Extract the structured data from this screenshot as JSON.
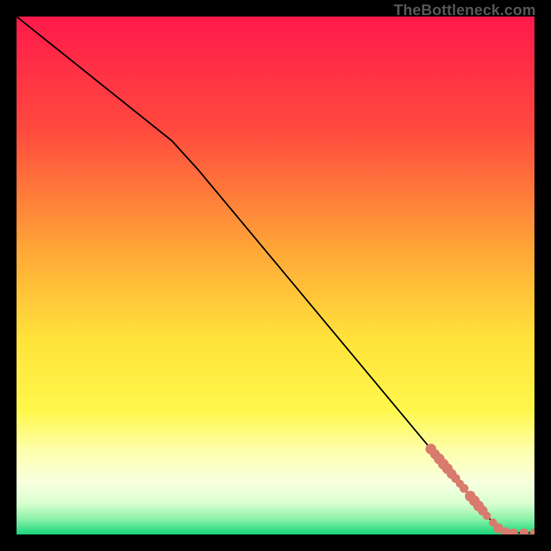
{
  "watermark": "TheBottleneck.com",
  "chart_data": {
    "type": "line",
    "title": "",
    "xlabel": "",
    "ylabel": "",
    "xlim": [
      0,
      100
    ],
    "ylim": [
      0,
      100
    ],
    "gradient_stops": [
      {
        "offset": 0,
        "color": "#ff1a4b"
      },
      {
        "offset": 22,
        "color": "#ff4a3e"
      },
      {
        "offset": 45,
        "color": "#ffa637"
      },
      {
        "offset": 62,
        "color": "#ffe23a"
      },
      {
        "offset": 76,
        "color": "#fff74a"
      },
      {
        "offset": 84,
        "color": "#fdffae"
      },
      {
        "offset": 90,
        "color": "#f8ffe0"
      },
      {
        "offset": 94,
        "color": "#d9ffd0"
      },
      {
        "offset": 97,
        "color": "#8cf2a8"
      },
      {
        "offset": 100,
        "color": "#17d67b"
      }
    ],
    "series": [
      {
        "name": "main-curve",
        "stroke": "#000000",
        "x": [
          0,
          5,
          10,
          15,
          20,
          25,
          30,
          35,
          40,
          45,
          50,
          55,
          60,
          65,
          70,
          75,
          80,
          85,
          90,
          93,
          96,
          100
        ],
        "y": [
          100,
          96,
          92,
          88,
          84,
          80,
          76,
          70.5,
          64.5,
          58.5,
          52.5,
          46.5,
          40.5,
          34.5,
          28.5,
          22.5,
          16.5,
          10.5,
          4.5,
          1.2,
          0.3,
          0.3
        ]
      }
    ],
    "markers": {
      "name": "bottleneck-points",
      "color": "#d87b6c",
      "points": [
        {
          "x": 80.0,
          "y": 16.5,
          "r": 1.2
        },
        {
          "x": 80.8,
          "y": 15.5,
          "r": 1.1
        },
        {
          "x": 81.6,
          "y": 14.6,
          "r": 1.2
        },
        {
          "x": 82.4,
          "y": 13.6,
          "r": 1.2
        },
        {
          "x": 83.2,
          "y": 12.7,
          "r": 1.2
        },
        {
          "x": 84.0,
          "y": 11.7,
          "r": 1.1
        },
        {
          "x": 84.8,
          "y": 10.8,
          "r": 1.0
        },
        {
          "x": 85.6,
          "y": 9.8,
          "r": 0.9
        },
        {
          "x": 86.4,
          "y": 8.9,
          "r": 1.0
        },
        {
          "x": 87.6,
          "y": 7.4,
          "r": 1.2
        },
        {
          "x": 88.4,
          "y": 6.5,
          "r": 1.2
        },
        {
          "x": 89.2,
          "y": 5.5,
          "r": 1.2
        },
        {
          "x": 90.0,
          "y": 4.6,
          "r": 1.1
        },
        {
          "x": 90.8,
          "y": 3.6,
          "r": 0.9
        },
        {
          "x": 92.0,
          "y": 2.3,
          "r": 0.9
        },
        {
          "x": 93.0,
          "y": 1.2,
          "r": 1.1
        },
        {
          "x": 94.5,
          "y": 0.5,
          "r": 1.0
        },
        {
          "x": 96.0,
          "y": 0.3,
          "r": 1.0
        },
        {
          "x": 98.0,
          "y": 0.3,
          "r": 1.0
        },
        {
          "x": 100.0,
          "y": 0.3,
          "r": 1.0
        }
      ]
    }
  }
}
